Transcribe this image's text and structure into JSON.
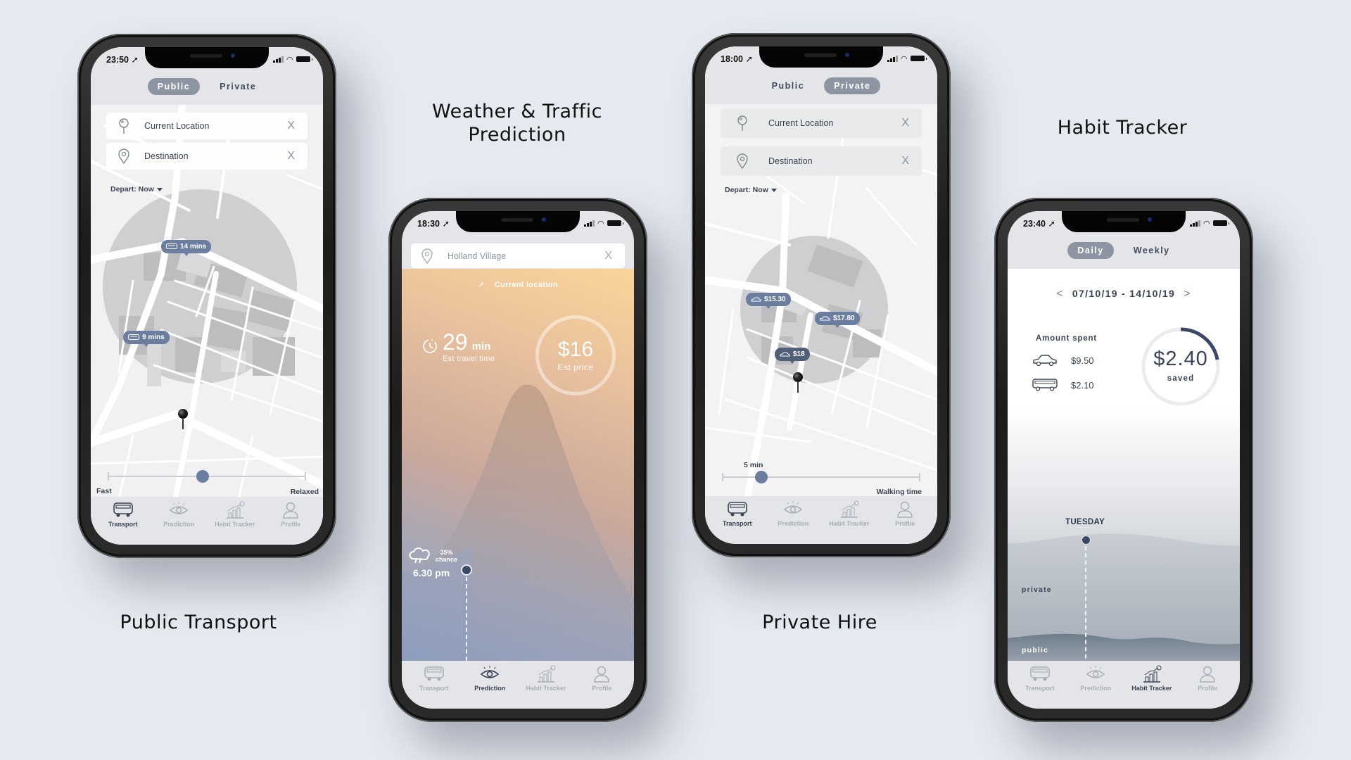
{
  "captions": {
    "public_transport": "Public Transport",
    "weather_prediction_line1": "Weather & Traffic",
    "weather_prediction_line2": "Prediction",
    "private_hire": "Private Hire",
    "habit_tracker": "Habit Tracker"
  },
  "tabbar": {
    "items": [
      {
        "label": "Transport",
        "icon": "bus-icon"
      },
      {
        "label": "Prediction",
        "icon": "eye-icon"
      },
      {
        "label": "Habit Tracker",
        "icon": "chart-icon"
      },
      {
        "label": "Profile",
        "icon": "profile-icon"
      }
    ]
  },
  "phone_public": {
    "time": "23:50",
    "segment": {
      "options": [
        "Public",
        "Private"
      ],
      "active": "Public"
    },
    "current_location": {
      "label": "Current Location",
      "clear": "X"
    },
    "destination": {
      "label": "Destination",
      "clear": "X"
    },
    "depart": "Depart: Now",
    "bubbles": [
      {
        "icon": "bus-icon",
        "text": "14 mins"
      },
      {
        "icon": "bus-icon",
        "text": "9 mins"
      }
    ],
    "slider": {
      "left_label": "Fast",
      "right_label": "Relaxed",
      "value_fraction": 0.48
    },
    "active_tab": "Transport"
  },
  "phone_weather": {
    "time": "18:30",
    "search_value": "Holland Village",
    "clear": "X",
    "current_location": "Current location",
    "travel_time": {
      "value": "29",
      "unit": "min",
      "label": "Est travel time"
    },
    "price": {
      "value": "$16",
      "label": "Est price"
    },
    "rain": {
      "chance": "35%",
      "chance_label": "chance",
      "time": "6.30 pm"
    },
    "active_tab": "Prediction"
  },
  "phone_private": {
    "time": "18:00",
    "segment": {
      "options": [
        "Public",
        "Private"
      ],
      "active": "Private"
    },
    "current_location": {
      "label": "Current Location",
      "clear": "X"
    },
    "destination": {
      "label": "Destination",
      "clear": "X"
    },
    "depart": "Depart: Now",
    "bubbles": [
      {
        "icon": "car-icon",
        "text": "$15.30"
      },
      {
        "icon": "car-icon",
        "text": "$17.80"
      },
      {
        "icon": "car-icon",
        "text": "$18"
      }
    ],
    "slider": {
      "value_label": "5 min",
      "right_label": "Walking time",
      "value_fraction": 0.2
    },
    "active_tab": "Transport"
  },
  "phone_habit": {
    "time": "23:40",
    "segment": {
      "options": [
        "Daily",
        "Weekly"
      ],
      "active": "Daily"
    },
    "date_range": "07/10/19 - 14/10/19",
    "prev": "<",
    "next": ">",
    "amount_spent_title": "Amount spent",
    "spent": [
      {
        "icon": "car-icon",
        "amount": "$9.50"
      },
      {
        "icon": "bus-icon",
        "amount": "$2.10"
      }
    ],
    "saved": {
      "value": "$2.40",
      "label": "saved",
      "progress_fraction": 0.22
    },
    "chart": {
      "day": "TUESDAY",
      "series": [
        "private",
        "public"
      ]
    },
    "active_tab": "Habit Tracker"
  }
}
